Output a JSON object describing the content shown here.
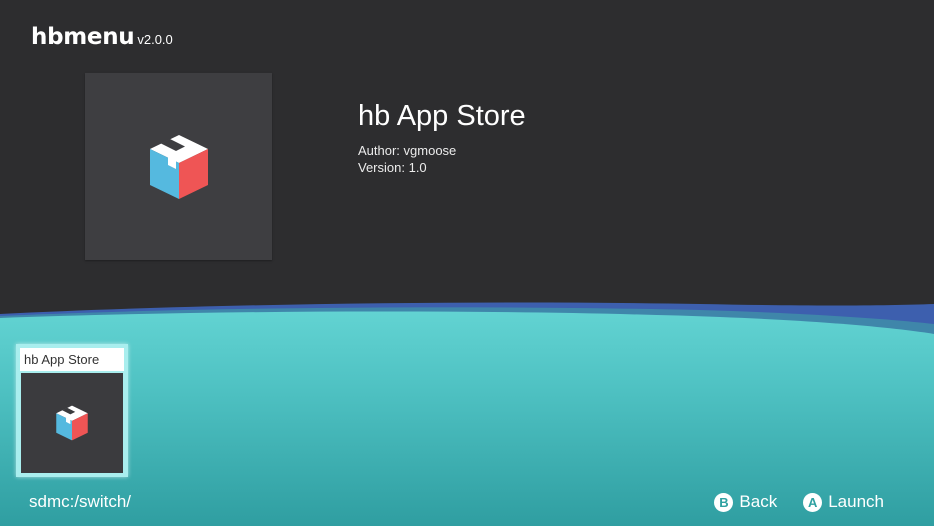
{
  "app": {
    "name": "hbmenu",
    "version": "v2.0.0"
  },
  "selected": {
    "title": "hb App Store",
    "author": "Author: vgmoose",
    "version": "Version: 1.0",
    "icon": "package-box-icon"
  },
  "apps": [
    {
      "label": "hb App Store",
      "icon": "package-box-icon"
    }
  ],
  "footer": {
    "path": "sdmc:/switch/",
    "hints": [
      {
        "key": "B",
        "label": "Back",
        "icon": "b-button-icon"
      },
      {
        "key": "A",
        "label": "Launch",
        "icon": "a-button-icon"
      }
    ]
  },
  "colors": {
    "background": "#2d2d2f",
    "teal": "#5ccfcf",
    "accent_blue": "#3d5fae",
    "selection_border": "#a9eeee"
  }
}
